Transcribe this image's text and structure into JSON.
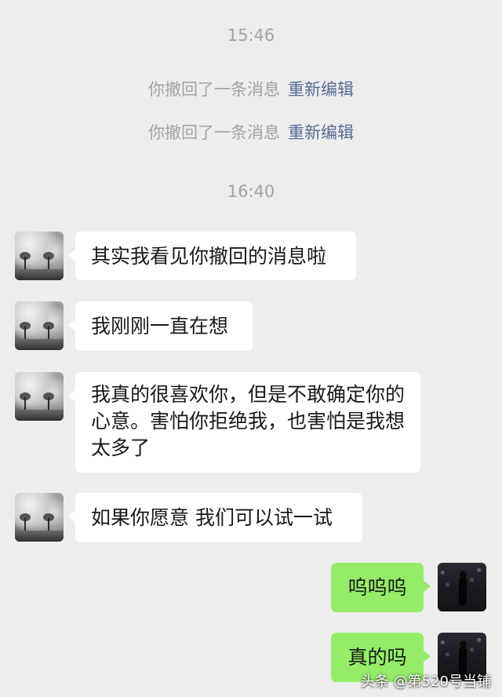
{
  "chat": {
    "timestamps": [
      "15:46",
      "16:40"
    ],
    "recall_notices": [
      {
        "text": "你撤回了一条消息",
        "action": "重新编辑"
      },
      {
        "text": "你撤回了一条消息",
        "action": "重新编辑"
      }
    ],
    "incoming_messages": [
      "其实我看见你撤回的消息啦",
      "我刚刚一直在想",
      "我真的很喜欢你，但是不敢确定你的心意。害怕你拒绝我，也害怕是我想太多了",
      "如果你愿意 我们可以试一试"
    ],
    "outgoing_messages": [
      "呜呜呜",
      "真的吗"
    ]
  },
  "watermark": "头条 @第520号当铺",
  "colors": {
    "background": "#ededed",
    "incoming_bubble": "#ffffff",
    "outgoing_bubble": "#95ec69",
    "link": "#576b95",
    "system_text": "#a3a3a3"
  }
}
